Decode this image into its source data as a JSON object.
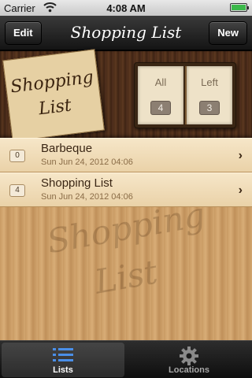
{
  "status_bar": {
    "carrier": "Carrier",
    "time": "4:08 AM",
    "battery_level": 1.0
  },
  "navbar": {
    "edit_label": "Edit",
    "title": "Shopping List",
    "new_label": "New"
  },
  "logo_card": {
    "line1": "Shopping",
    "line2": "List"
  },
  "summary": {
    "all_label": "All",
    "all_count": "4",
    "left_label": "Left",
    "left_count": "3"
  },
  "lists": [
    {
      "count": "0",
      "title": "Barbeque",
      "date": "Sun Jun 24, 2012 04:06"
    },
    {
      "count": "4",
      "title": "Shopping List",
      "date": "Sun Jun 24, 2012 04:06"
    }
  ],
  "watermark": {
    "line1": "Shopping",
    "line2": "List"
  },
  "tabbar": {
    "tabs": [
      {
        "label": "Lists",
        "icon": "list-icon",
        "selected": true
      },
      {
        "label": "Locations",
        "icon": "gear-icon",
        "selected": false
      }
    ]
  },
  "colors": {
    "accent_blue": "#4a8fe8",
    "battery_green": "#3cb84a",
    "text_dark": "#3a2614"
  }
}
